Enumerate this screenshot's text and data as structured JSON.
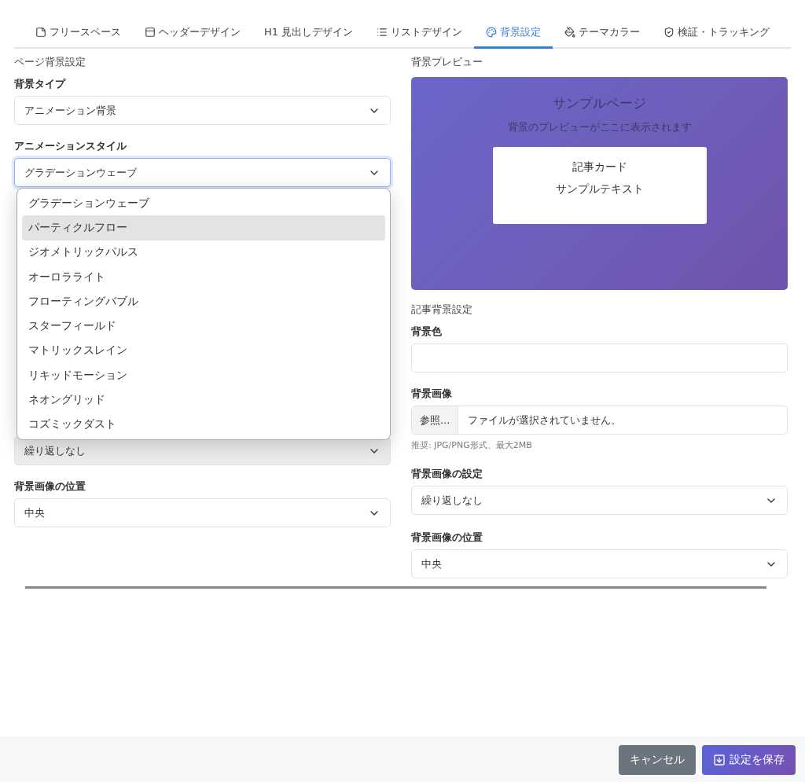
{
  "tabs": [
    {
      "label": "フリースペース",
      "kind": "note",
      "selected": false
    },
    {
      "label": "ヘッダーデザイン",
      "kind": "layout",
      "selected": false
    },
    {
      "label": "H1 見出しデザイン",
      "kind": "plain",
      "selected": false
    },
    {
      "label": "リストデザイン",
      "kind": "list",
      "selected": false
    },
    {
      "label": "背景設定",
      "kind": "palette",
      "selected": true
    },
    {
      "label": "テーマカラー",
      "kind": "bucket",
      "selected": false
    },
    {
      "label": "検証・トラッキング",
      "kind": "shield",
      "selected": false
    }
  ],
  "page_background": {
    "heading": "ページ背景設定",
    "type_label": "背景タイプ",
    "type_value": "アニメーション背景",
    "style_label": "アニメーションスタイル",
    "style_value": "グラデーションウェーブ",
    "style_options": [
      {
        "label": "グラデーションウェーブ",
        "selected": false
      },
      {
        "label": "パーティクルフロー",
        "selected": true
      },
      {
        "label": "ジオメトリックパルス",
        "selected": false
      },
      {
        "label": "オーロラライト",
        "selected": false
      },
      {
        "label": "フローティングバブル",
        "selected": false
      },
      {
        "label": "スターフィールド",
        "selected": false
      },
      {
        "label": "マトリックスレイン",
        "selected": false
      },
      {
        "label": "リキッドモーション",
        "selected": false
      },
      {
        "label": "ネオングリッド",
        "selected": false
      },
      {
        "label": "コズミックダスト",
        "selected": false
      }
    ],
    "repeat_value": "繰り返しなし",
    "position_label": "背景画像の位置",
    "position_value": "中央"
  },
  "preview": {
    "heading": "背景プレビュー",
    "title": "サンプルページ",
    "subtitle": "背景のプレビューがここに表示されます",
    "card_title": "記事カード",
    "card_text": "サンプルテキスト"
  },
  "article_background": {
    "heading": "記事背景設定",
    "color_label": "背景色",
    "image_label": "背景画像",
    "browse_button": "参照...",
    "file_text": "ファイルが選択されていません。",
    "hint": "推奨: JPG/PNG形式、最大2MB",
    "repeat_label": "背景画像の設定",
    "repeat_value": "繰り返しなし",
    "position_label": "背景画像の位置",
    "position_value": "中央"
  },
  "footer": {
    "cancel": "キャンセル",
    "save": "設定を保存"
  }
}
